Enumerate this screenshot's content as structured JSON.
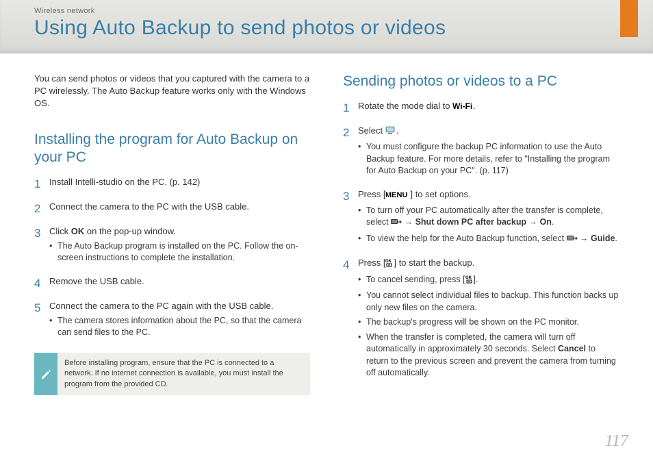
{
  "header": {
    "category": "Wireless network",
    "title": "Using Auto Backup to send photos or videos"
  },
  "intro": "You can send photos or videos that you captured with the camera to a PC wirelessly. The Auto Backup feature works only with the Windows OS.",
  "left": {
    "heading": "Installing the program for Auto Backup on your PC",
    "steps": [
      {
        "num": "1",
        "text": "Install Intelli-studio on the PC. (p. 142)"
      },
      {
        "num": "2",
        "text": "Connect the camera to the PC with the USB cable."
      },
      {
        "num": "3",
        "text_before": "Click ",
        "bold": "OK",
        "text_after": " on the pop-up window.",
        "subs": [
          "The Auto Backup program is installed on the PC. Follow the on-screen instructions to complete the installation."
        ]
      },
      {
        "num": "4",
        "text": "Remove the USB cable."
      },
      {
        "num": "5",
        "text": "Connect the camera to the PC again with the USB cable.",
        "subs": [
          "The camera stores information about the PC, so that the camera can send files to the PC."
        ]
      }
    ],
    "note": "Before installing program, ensure that the PC is connected to a network. If no internet connection is available, you must install the program from the provided CD."
  },
  "right": {
    "heading": "Sending photos or videos to a PC",
    "steps": [
      {
        "num": "1",
        "prefix": "Rotate the mode dial to ",
        "icon": "wifi",
        "suffix": "."
      },
      {
        "num": "2",
        "prefix": "Select ",
        "icon": "pc",
        "suffix": ".",
        "subs": [
          "You must configure the backup PC information to use the Auto Backup feature. For more details, refer to \"Installing the program for Auto Backup on your PC\". (p. 117)"
        ]
      },
      {
        "num": "3",
        "prefix": "Press [",
        "icon": "menu",
        "suffix": "] to set options.",
        "subs_rich": [
          {
            "before": "To turn off your PC automatically after the transfer is complete, select ",
            "icon": "pc-arrow",
            "after_bold": " → Shut down PC after backup → On",
            "tail": "."
          },
          {
            "before": "To view the help for the Auto Backup function, select ",
            "icon": "pc-arrow",
            "after": " → ",
            "bold": "Guide",
            "tail": "."
          }
        ]
      },
      {
        "num": "4",
        "prefix": "Press [",
        "icon": "ok",
        "suffix": "] to start the backup.",
        "subs_rich": [
          {
            "before": "To cancel sending, press [",
            "icon": "ok",
            "after": "]."
          },
          {
            "plain": "You cannot select individual files to backup. This function backs up only new files on the camera."
          },
          {
            "plain": "The backup's progress will be shown on the PC monitor."
          },
          {
            "before": "When the transfer is completed, the camera will turn off automatically in approximately 30 seconds. Select ",
            "bold": "Cancel",
            "after": " to return to the previous screen and prevent the camera from turning off automatically."
          }
        ]
      }
    ]
  },
  "page_number": "117"
}
